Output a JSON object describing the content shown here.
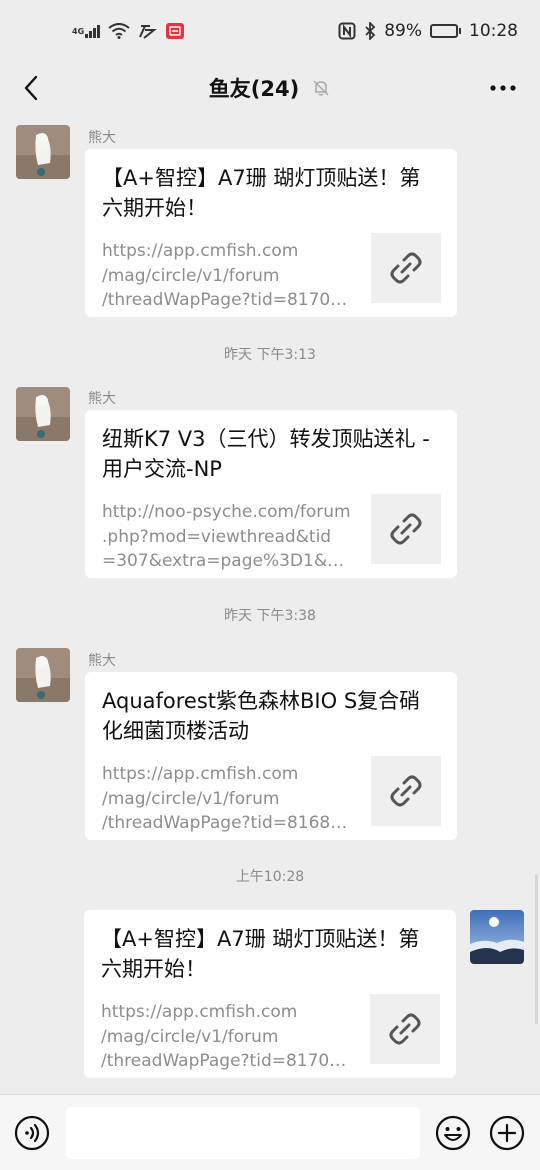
{
  "status_bar": {
    "network_type": "4G",
    "battery_percent": "89%",
    "time": "10:28",
    "battery_level": 0.89
  },
  "nav": {
    "title": "鱼友(24)",
    "icons": [
      "back-arrow-icon",
      "mute-bell-icon",
      "more-dots-icon"
    ]
  },
  "messages": [
    {
      "sender": "熊大",
      "title": "【A+智控】A7珊 瑚灯顶贴送！第六期开始！",
      "url_lines": [
        "https://app.cmfish.com",
        "/mag/circle/v1/forum",
        "/threadWapPage?tid=81709..."
      ]
    },
    {
      "timestamp": "昨天 下午3:13",
      "sender": "熊大",
      "title": "纽斯K7 V3（三代）转发顶贴送礼 - 用户交流-NP",
      "url_lines": [
        "http://noo-psyche.com/forum",
        ".php?mod=viewthread&tid",
        "=307&extra=page%3D1&mo..."
      ]
    },
    {
      "timestamp": "昨天 下午3:38",
      "sender": "熊大",
      "title": "Aquaforest紫色森林BIO S复合硝化细菌顶楼活动",
      "url_lines": [
        "https://app.cmfish.com",
        "/mag/circle/v1/forum",
        "/threadWapPage?tid=81683..."
      ]
    },
    {
      "timestamp": "上午10:28",
      "title": "【A+智控】A7珊 瑚灯顶贴送！第六期开始！",
      "url_lines": [
        "https://app.cmfish.com",
        "/mag/circle/v1/forum",
        "/threadWapPage?tid=81709..."
      ]
    }
  ],
  "input_bar": {
    "placeholder": "",
    "icons": [
      "voice-icon",
      "emoji-icon",
      "plus-icon"
    ]
  },
  "colors": {
    "background": "#ededed",
    "card": "#ffffff",
    "meta_text": "#8a8a8a"
  }
}
